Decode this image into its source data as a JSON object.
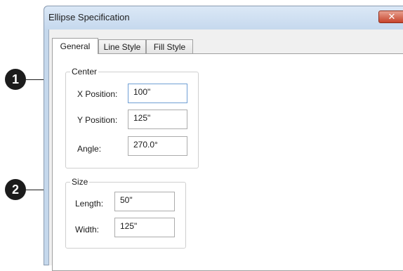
{
  "dialog": {
    "title": "Ellipse Specification",
    "close_glyph": "✕"
  },
  "callouts": [
    "1",
    "2"
  ],
  "tabs": [
    {
      "label": "General",
      "active": true
    },
    {
      "label": "Line Style",
      "active": false
    },
    {
      "label": "Fill Style",
      "active": false
    }
  ],
  "center": {
    "legend": "Center",
    "x_label": "X Position:",
    "x_value": "100\"",
    "y_label": "Y Position:",
    "y_value": "125\"",
    "angle_label": "Angle:",
    "angle_value": "270.0°"
  },
  "size": {
    "legend": "Size",
    "length_label": "Length:",
    "length_value": "50\"",
    "width_label": "Width:",
    "width_value": "125\""
  }
}
